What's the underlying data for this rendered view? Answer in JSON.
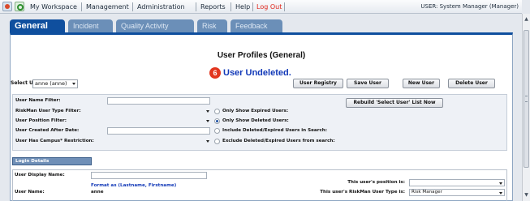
{
  "menu": {
    "items": [
      "My Workspace",
      "Management",
      "Administration",
      "Reports",
      "Help"
    ],
    "logout": "Log Out",
    "user_label": "USER: System Manager (Manager)"
  },
  "tabs": [
    "General",
    "Incident",
    "Quality Activity",
    "Risk",
    "Feedback"
  ],
  "page": {
    "title": "User Profiles (General)",
    "notice_number": "6",
    "notice": "User Undeleted."
  },
  "select_user": {
    "label": "Select User:",
    "value": "anne (anne)"
  },
  "buttons": {
    "registry": "User Registry",
    "save": "Save User",
    "new": "New User",
    "delete": "Delete User",
    "rebuild": "Rebuild 'Select User' List Now"
  },
  "filters": {
    "labels": [
      "User Name Filter:",
      "RiskMan User Type Filter:",
      "User Position Filter:",
      "User Created After Date:",
      "User Has Campus* Restriction:"
    ],
    "options": [
      {
        "label": "Only Show Expired Users:",
        "checked": false
      },
      {
        "label": "Only Show Deleted Users:",
        "checked": true
      },
      {
        "label": "Include Deleted/Expired Users in Search:",
        "checked": false
      },
      {
        "label": "Exclude Deleted/Expired Users from search:",
        "checked": false
      }
    ]
  },
  "login": {
    "header": "Login Details",
    "display_name_label": "User Display Name:",
    "format_hint": "Format as (Lastname, Firstname)",
    "username_label": "User Name:",
    "username_value": "anne",
    "position_label": "This user's position is:",
    "position_value": "",
    "type_label": "This user's RiskMan User Type is:",
    "type_value": "Risk Manager"
  },
  "colors": {
    "accent": "#0f4f9e",
    "logout": "#e0261b",
    "notice": "#1239b8",
    "notice_icon": "#e2361f"
  }
}
